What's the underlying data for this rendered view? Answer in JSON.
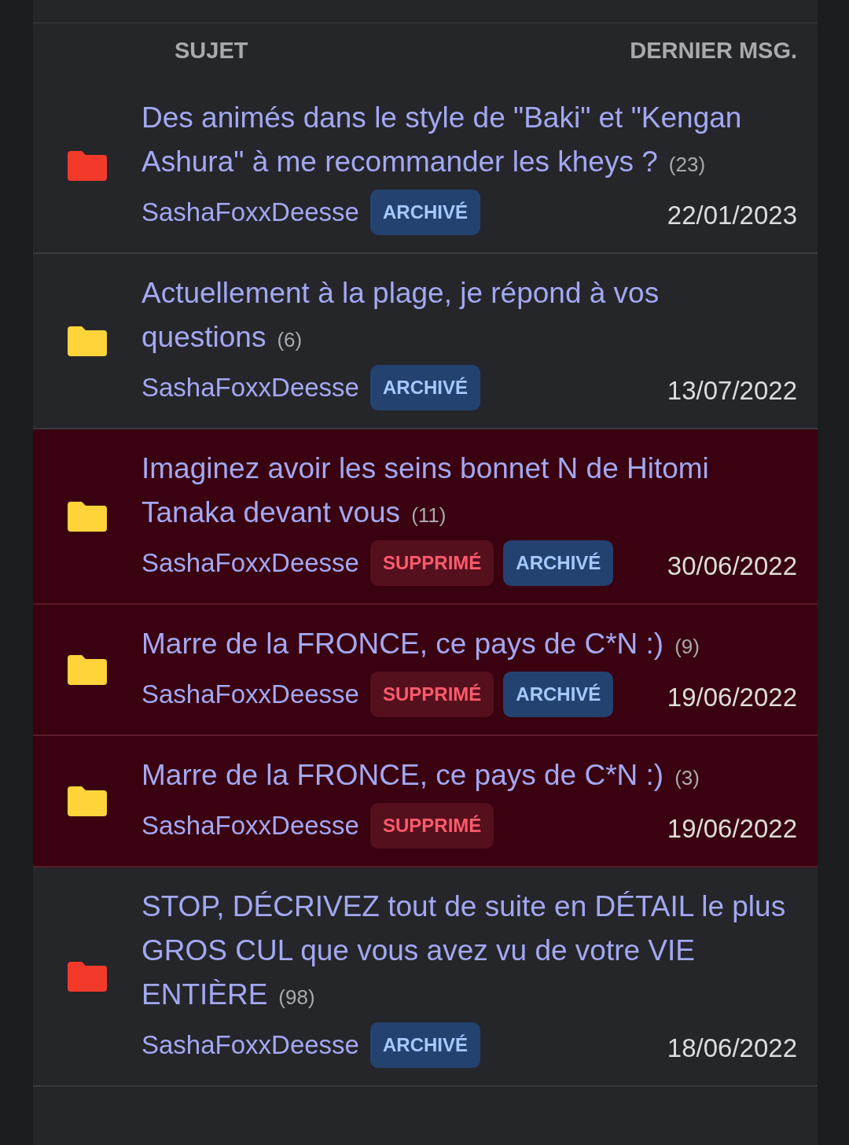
{
  "header": {
    "subject": "SUJET",
    "last_message": "DERNIER MSG."
  },
  "topics": [
    {
      "title": "Des animés dans le style de \"Baki\" et \"Kengan Ashura\" à me recommander les kheys ?",
      "count": "(23)",
      "color": "#f23a2b",
      "deleted": false,
      "author": "SashaFoxxDeesse",
      "tags": [
        {
          "kind": "archived",
          "label": "ARCHIVÉ"
        }
      ],
      "date": "22/01/2023"
    },
    {
      "title": "Actuellement à la plage, je répond à vos questions",
      "count": "(6)",
      "color": "#ffd43b",
      "deleted": false,
      "author": "SashaFoxxDeesse",
      "tags": [
        {
          "kind": "archived",
          "label": "ARCHIVÉ"
        }
      ],
      "date": "13/07/2022"
    },
    {
      "title": "Imaginez avoir les seins bonnet N de Hitomi Tanaka devant vous",
      "count": "(11)",
      "color": "#ffd43b",
      "deleted": true,
      "author": "SashaFoxxDeesse",
      "tags": [
        {
          "kind": "deleted",
          "label": "SUPPRIMÉ"
        },
        {
          "kind": "archived",
          "label": "ARCHIVÉ"
        }
      ],
      "date": "30/06/2022"
    },
    {
      "title": "Marre de la FRONCE, ce pays de C*N :)",
      "count": "(9)",
      "color": "#ffd43b",
      "deleted": true,
      "author": "SashaFoxxDeesse",
      "tags": [
        {
          "kind": "deleted",
          "label": "SUPPRIMÉ"
        },
        {
          "kind": "archived",
          "label": "ARCHIVÉ"
        }
      ],
      "date": "19/06/2022"
    },
    {
      "title": "Marre de la FRONCE, ce pays de C*N :)",
      "count": "(3)",
      "color": "#ffd43b",
      "deleted": true,
      "author": "SashaFoxxDeesse",
      "tags": [
        {
          "kind": "deleted",
          "label": "SUPPRIMÉ"
        }
      ],
      "date": "19/06/2022"
    },
    {
      "title": "STOP, DÉCRIVEZ tout de suite en DÉTAIL le plus GROS CUL que vous avez vu de votre VIE ENTIÈRE",
      "count": "(98)",
      "color": "#f23a2b",
      "deleted": false,
      "author": "SashaFoxxDeesse",
      "tags": [
        {
          "kind": "archived",
          "label": "ARCHIVÉ"
        }
      ],
      "date": "18/06/2022"
    }
  ]
}
